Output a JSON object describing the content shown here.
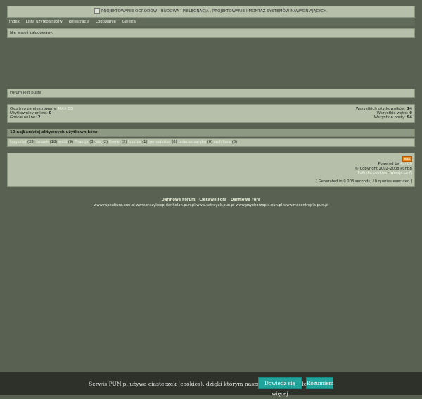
{
  "header": {
    "title": "PROJEKTOWANIE OGRODÓW - BUDOWA I PIELĘGNACJA , PROJEKTOWANIE I MONTAŻ SYSTEMÓW NAWADNIAJĄCYCH."
  },
  "nav": {
    "items": [
      "Index",
      "Lista użytkowników",
      "Rejestracja",
      "Logowanie",
      "Galeria"
    ]
  },
  "status": {
    "text": "Nie jesteś zalogowany."
  },
  "forum": {
    "empty_text": "Forum jest puste"
  },
  "stats": {
    "newest_label": "Ostatnio zarejestrowany:",
    "newest_user": "MAX CO",
    "online_label": "Użytkownicy online:",
    "online_value": "0",
    "guests_label": "Goście online:",
    "guests_value": "2",
    "total_users_label": "Wszystkich użytkowników:",
    "total_users_value": "14",
    "total_topics_label": "Wszystkie wątki:",
    "total_topics_value": "9",
    "total_posts_label": "Wszystkie posty:",
    "total_posts_value": "94"
  },
  "top_users": {
    "heading": "10 najbardziej aktywnych użytkowników:",
    "users": [
      {
        "name": "krzysztof",
        "count": "(28)"
      },
      {
        "name": "Leszek",
        "count": "(18)"
      },
      {
        "name": "wald",
        "count": "(9)"
      },
      {
        "name": "Pirazzja",
        "count": "(3)"
      },
      {
        "name": "ola",
        "count": "(2)"
      },
      {
        "name": "Daniel",
        "count": "(2)"
      },
      {
        "name": "krzztos",
        "count": "(1)"
      },
      {
        "name": "bernadettes",
        "count": "(0)"
      },
      {
        "name": "tadeusz zaręba",
        "count": "(0)"
      },
      {
        "name": "orchifiore",
        "count": "(0)"
      }
    ]
  },
  "footer": {
    "rss": "RSS",
    "powered_by": "Powered by",
    "punbb": "PunBB",
    "copyright": "© Copyright 2002–2008 PunBB",
    "privacy": "Polityka cookies",
    "version": "Wersja Lo-Fi",
    "generated": "[ Generated in 0.008 seconds, 10 queries executed ]"
  },
  "partners": {
    "bold_links": [
      "Darmowe Forum",
      "Ciekawe Fora",
      "Darmowe Fora"
    ],
    "sites": "www.rapkultura.pun.pl www.crazykeep-danhelan.pun.pl www.satrayek.pun.pl www.psychorzopki.pun.pl www.mcsentropia.pun.pl"
  },
  "cookie": {
    "text": "Serwis PUN.pl używa ciasteczek (cookies), dzięki którym nasze fora mogą działać lepiej.",
    "accept": "Dowiedz się więcej",
    "more": "Rozumiem"
  }
}
